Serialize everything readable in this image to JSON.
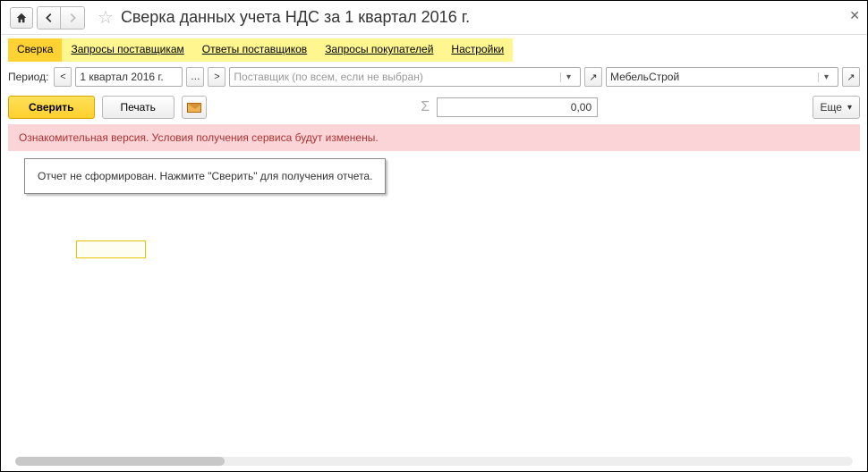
{
  "title": "Сверка данных учета НДС за 1 квартал 2016 г.",
  "tabs": {
    "items": [
      "Сверка",
      "Запросы поставщикам",
      "Ответы поставщиков",
      "Запросы покупателей",
      "Настройки"
    ],
    "active_index": 0
  },
  "filters": {
    "period_label": "Период:",
    "period_value": "1 квартал 2016 г.",
    "supplier_placeholder": "Поставщик (по всем, если не выбран)",
    "organization_value": "МебельСтрой"
  },
  "toolbar": {
    "verify_label": "Сверить",
    "print_label": "Печать",
    "sum_value": "0,00",
    "more_label": "Еще"
  },
  "banner": "Ознакомительная версия. Условия получения сервиса будут изменены.",
  "content": {
    "message": "Отчет не сформирован. Нажмите \"Сверить\" для получения отчета."
  }
}
